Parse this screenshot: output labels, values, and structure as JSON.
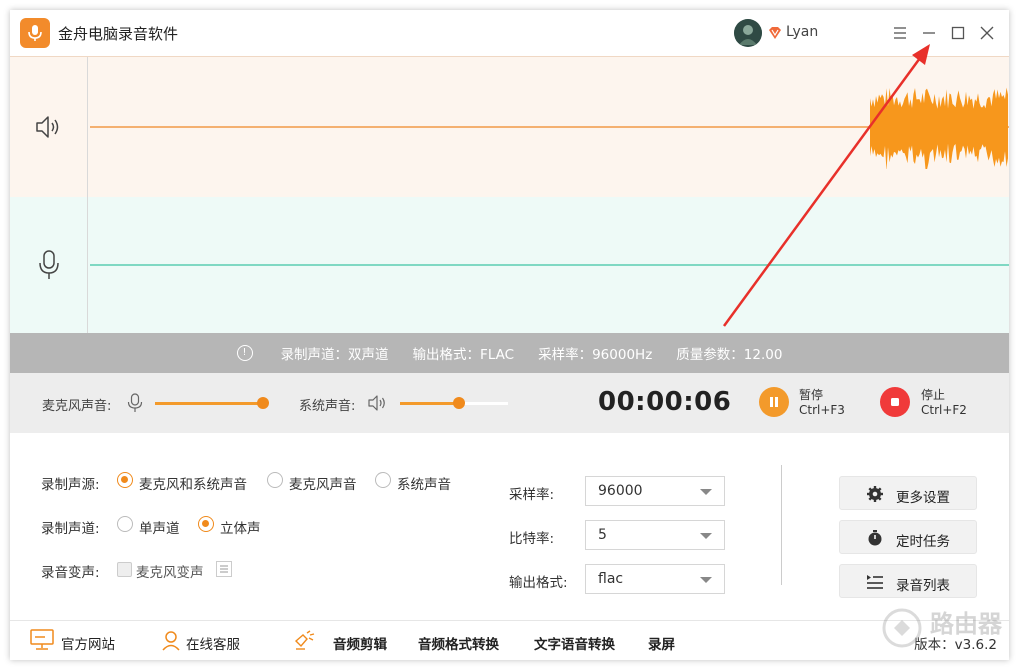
{
  "app": {
    "title": "金舟电脑录音软件",
    "username": "Lyan"
  },
  "info_bar": {
    "channel": "录制声道：双声道",
    "format": "输出格式：FLAC",
    "sample_rate": "采样率：96000Hz",
    "quality": "质量参数：12.00"
  },
  "controls": {
    "mic_label": "麦克风声音:",
    "sys_label": "系统声音:",
    "mic_volume": 1.0,
    "sys_volume": 0.55,
    "timer": "00:00:06",
    "pause_label": "暂停",
    "pause_shortcut": "Ctrl+F3",
    "stop_label": "停止",
    "stop_shortcut": "Ctrl+F2"
  },
  "settings": {
    "source_label": "录制声源:",
    "source_options": [
      "麦克风和系统声音",
      "麦克风声音",
      "系统声音"
    ],
    "source_selected": "麦克风和系统声音",
    "channel_label": "录制声道:",
    "channel_options": [
      "单声道",
      "立体声"
    ],
    "channel_selected": "立体声",
    "voice_change_label": "录音变声:",
    "voice_change_option": "麦克风变声",
    "sample_rate_label": "采样率:",
    "sample_rate_value": "96000",
    "bitrate_label": "比特率:",
    "bitrate_value": "5",
    "format_label": "输出格式:",
    "format_value": "flac",
    "more_settings": "更多设置",
    "scheduled_task": "定时任务",
    "recording_list": "录音列表"
  },
  "footer": {
    "website": "官方网站",
    "support": "在线客服",
    "audio_edit": "音频剪辑",
    "audio_convert": "音频格式转换",
    "tts": "文字语音转换",
    "screen_record": "录屏",
    "version": "版本：v3.6.2",
    "watermark": "路由器"
  },
  "colors": {
    "accent": "#f08a1c",
    "stop": "#f03a3a",
    "mic_line": "#7fd8c3",
    "sys_line": "#f4b070",
    "annotation_arrow": "#e8302a"
  }
}
